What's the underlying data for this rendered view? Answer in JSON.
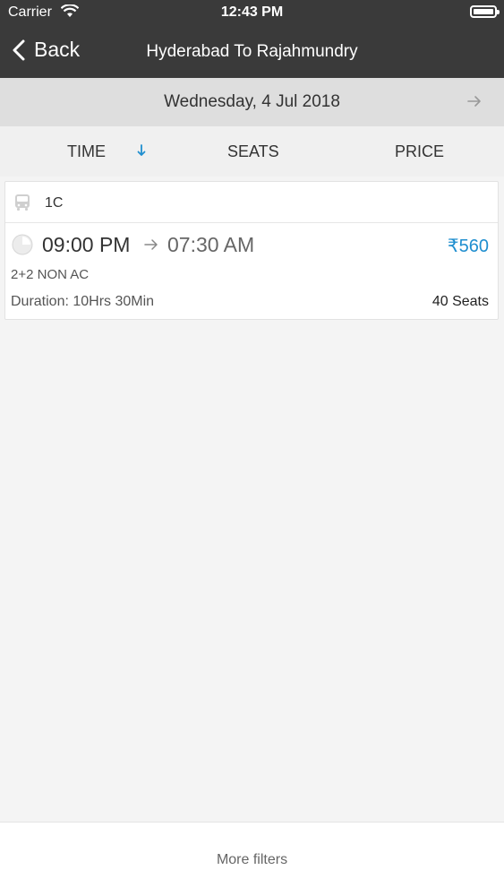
{
  "status_bar": {
    "carrier": "Carrier",
    "time": "12:43 PM"
  },
  "nav": {
    "back_label": "Back",
    "title": "Hyderabad To Rajahmundry"
  },
  "date_bar": {
    "date": "Wednesday, 4 Jul 2018"
  },
  "sort": {
    "time_label": "TIME",
    "seats_label": "SEATS",
    "price_label": "PRICE"
  },
  "results": [
    {
      "operator": "1C",
      "departure": "09:00 PM",
      "arrival": "07:30 AM",
      "price": "₹560",
      "bus_type": "2+2 NON AC",
      "duration": "Duration: 10Hrs 30Min",
      "seats": "40 Seats"
    }
  ],
  "footer": {
    "more_filters": "More filters"
  },
  "colors": {
    "header": "#3a3a3a",
    "price": "#1f8ecf",
    "sort_accent": "#1f8ecf"
  }
}
